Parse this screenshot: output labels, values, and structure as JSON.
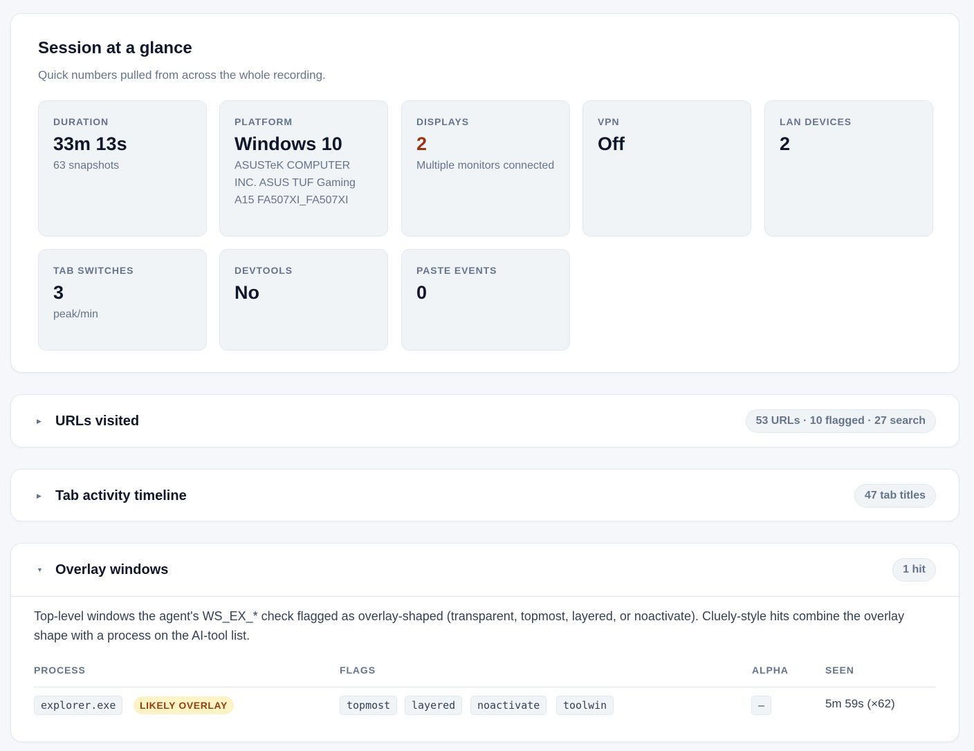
{
  "session": {
    "title": "Session at a glance",
    "subtitle": "Quick numbers pulled from across the whole recording.",
    "stats": {
      "duration": {
        "label": "Duration",
        "value": "33m 13s",
        "note": "63 snapshots"
      },
      "platform": {
        "label": "Platform",
        "value": "Windows 10",
        "note": "ASUSTeK COMPUTER INC. ASUS TUF Gaming A15 FA507XI_FA507XI"
      },
      "displays": {
        "label": "Displays",
        "value": "2",
        "note": "Multiple monitors connected",
        "value_color": "#9a3412"
      },
      "vpn": {
        "label": "VPN",
        "value": "Off"
      },
      "lan_devices": {
        "label": "LAN devices",
        "value": "2"
      },
      "tab_switches": {
        "label": "Tab switches",
        "value": "3",
        "note": "peak/min"
      },
      "devtools": {
        "label": "Devtools",
        "value": "No"
      },
      "paste_events": {
        "label": "Paste events",
        "value": "0"
      }
    }
  },
  "urls": {
    "title": "URLs visited",
    "summary": "53 URLs · 10 flagged · 27 search",
    "expanded": false
  },
  "tabs": {
    "title": "Tab activity timeline",
    "summary": "47 tab titles",
    "expanded": false
  },
  "overlay": {
    "title": "Overlay windows",
    "summary": "1 hit",
    "expanded": true,
    "description": "Top-level windows the agent's WS_EX_* check flagged as overlay-shaped (transparent, topmost, layered, or noactivate). Cluely-style hits combine the overlay shape with a process on the AI-tool list.",
    "columns": {
      "process": "Process",
      "flags": "Flags",
      "alpha": "Alpha",
      "seen": "Seen"
    },
    "rows": [
      {
        "process": "explorer.exe",
        "badge": "LIKELY OVERLAY",
        "flags": [
          "topmost",
          "layered",
          "noactivate",
          "toolwin"
        ],
        "alpha": "–",
        "seen": "5m 59s (×62)"
      }
    ]
  },
  "colors": {
    "accent_warn": "#9a3412",
    "badge_bg": "#fef3c7",
    "badge_text": "#92400e"
  }
}
